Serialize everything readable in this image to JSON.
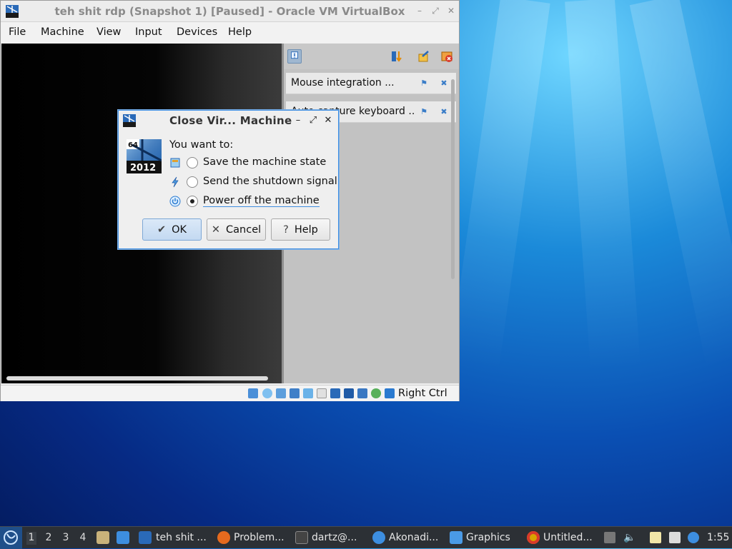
{
  "vbox": {
    "title": "teh shit rdp (Snapshot 1) [Paused] - Oracle VM VirtualBox",
    "menu": [
      "File",
      "Machine",
      "View",
      "Input",
      "Devices",
      "Help"
    ],
    "notifications": [
      {
        "text": "Mouse integration ..."
      },
      {
        "text": "Auto capture keyboard ..."
      }
    ],
    "status": {
      "host_key": "Right Ctrl"
    }
  },
  "dialog": {
    "title": "Close Vir... Machine",
    "icon_badge_top": "64",
    "icon_badge_bottom": "2012",
    "prompt": "You want to:",
    "options": [
      {
        "label": "Save the machine state",
        "checked": false
      },
      {
        "label": "Send the shutdown signal",
        "checked": false
      },
      {
        "label": "Power off the machine",
        "checked": true
      }
    ],
    "buttons": {
      "ok": "OK",
      "cancel": "Cancel",
      "help": "Help"
    }
  },
  "taskbar": {
    "workspaces": [
      "1",
      "2",
      "3",
      "4"
    ],
    "active_workspace": "1",
    "tasks": [
      {
        "label": "teh shit ..."
      },
      {
        "label": "Problem..."
      },
      {
        "label": "dartz@..."
      },
      {
        "label": "Akonadi..."
      },
      {
        "label": "Graphics"
      },
      {
        "label": "Untitled..."
      }
    ],
    "clock": "1:55"
  },
  "colors": {
    "accent": "#3f8de0",
    "desktop": "#0a4fb3",
    "taskbar": "#2c3035"
  }
}
